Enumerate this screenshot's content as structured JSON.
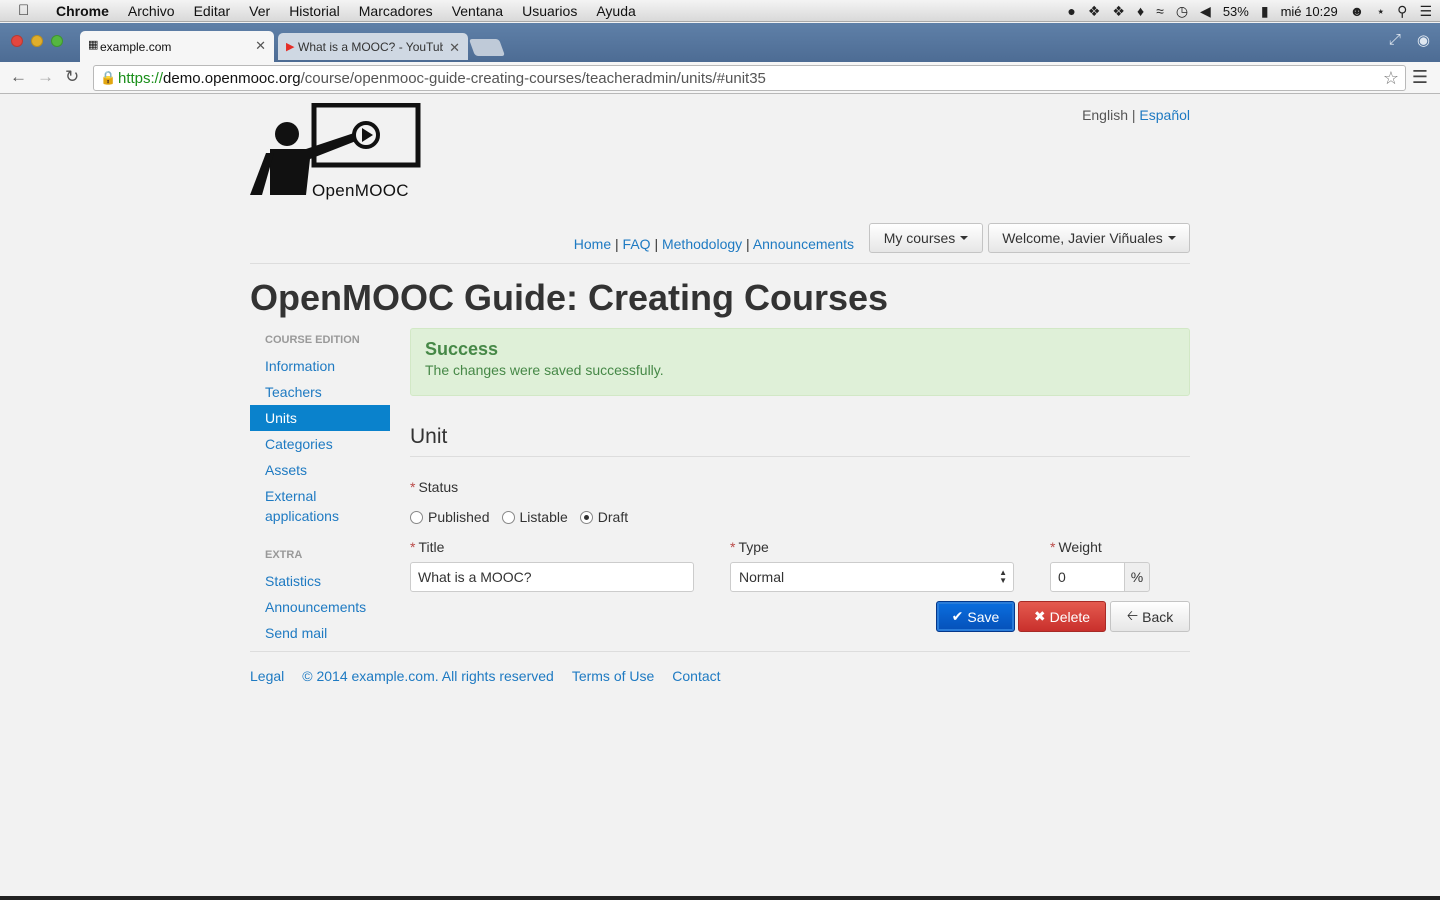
{
  "os_menubar": {
    "app_name": "Chrome",
    "menu_items": [
      "Archivo",
      "Editar",
      "Ver",
      "Historial",
      "Marcadores",
      "Ventana",
      "Usuarios",
      "Ayuda"
    ],
    "battery": "53%",
    "clock": "mié 10:29"
  },
  "browser": {
    "tabs": [
      {
        "title": "example.com"
      },
      {
        "title": "What is a MOOC? - YouTube"
      }
    ],
    "url": {
      "scheme": "https://",
      "host": "demo.openmooc.org",
      "path": "/course/openmooc-guide-creating-courses/teacheradmin/units/#unit35"
    }
  },
  "header": {
    "logo_text": "OpenMOOC",
    "lang_current": "English",
    "lang_separator": "|",
    "lang_other": "Español",
    "nav_links": [
      "Home",
      "FAQ",
      "Methodology",
      "Announcements"
    ],
    "nav_separator": "|",
    "my_courses": "My courses",
    "welcome": "Welcome, Javier Viñuales"
  },
  "page_title": "OpenMOOC Guide: Creating Courses",
  "sidebar": {
    "section1_title": "COURSE EDITION",
    "items1": [
      "Information",
      "Teachers",
      "Units",
      "Categories",
      "Assets",
      "External applications"
    ],
    "active": "Units",
    "section2_title": "EXTRA",
    "items2": [
      "Statistics",
      "Announcements",
      "Send mail"
    ]
  },
  "alert": {
    "title": "Success",
    "message": "The changes were saved successfully."
  },
  "form": {
    "heading": "Unit",
    "required_mark": "*",
    "status_label": "Status",
    "status_options": [
      "Published",
      "Listable",
      "Draft"
    ],
    "status_selected": "Draft",
    "title_label": "Title",
    "title_value": "What is a MOOC?",
    "type_label": "Type",
    "type_value": "Normal",
    "weight_label": "Weight",
    "weight_value": "0",
    "weight_addon": "%",
    "save_label": "Save",
    "delete_label": "Delete",
    "back_label": "Back"
  },
  "footer": {
    "legal": "Legal",
    "copyright": "© 2014 example.com. All rights reserved",
    "terms": "Terms of Use",
    "contact": "Contact"
  },
  "colors": {
    "link": "#1e7ac2",
    "active_nav": "#0a82cc",
    "success_bg": "#dff0d8",
    "success_text": "#468847",
    "save_btn": "#0550b8",
    "delete_btn": "#c9302c"
  }
}
